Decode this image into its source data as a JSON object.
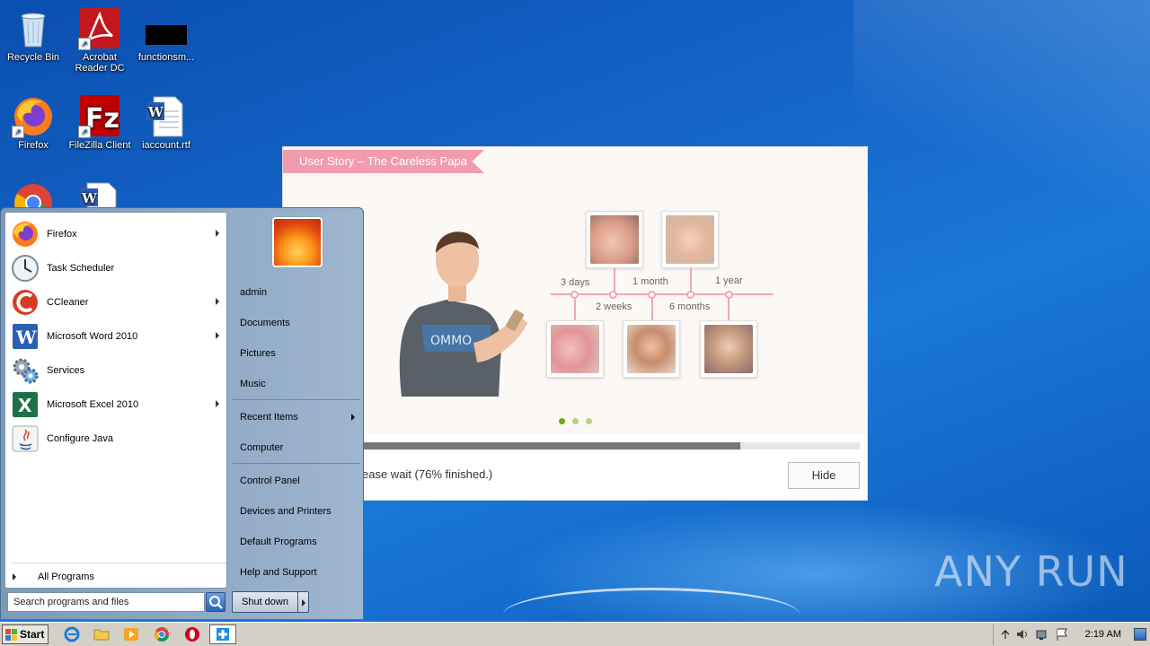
{
  "desktop": {
    "icons": [
      {
        "label": "Recycle Bin",
        "icon": "recycle-bin-icon"
      },
      {
        "label": "Acrobat Reader DC",
        "icon": "acrobat-icon"
      },
      {
        "label": "functionsm...",
        "icon": "black-file-icon"
      },
      {
        "label": "Firefox",
        "icon": "firefox-icon"
      },
      {
        "label": "FileZilla Client",
        "icon": "filezilla-icon"
      },
      {
        "label": "iaccount.rtf",
        "icon": "word-doc-icon"
      }
    ],
    "watermark": "ANY RUN"
  },
  "installer": {
    "ribbon_title": "User Story – The Careless Papa",
    "timeline_labels": [
      "3 days",
      "2 weeks",
      "1 month",
      "6 months",
      "1 year"
    ],
    "status_text": "ease wait (76% finished.)",
    "progress": 0.76,
    "hide_label": "Hide",
    "colors": {
      "ribbon": "#f29bb0",
      "pager_active": "#6aa81a",
      "pager_inactive": "#b8d27c"
    }
  },
  "start_menu": {
    "pinned": [
      {
        "label": "Firefox",
        "icon": "firefox-icon",
        "submenu": true
      },
      {
        "label": "Task Scheduler",
        "icon": "clock-icon",
        "submenu": false
      },
      {
        "label": "CCleaner",
        "icon": "ccleaner-icon",
        "submenu": true
      },
      {
        "label": "Microsoft Word 2010",
        "icon": "word-icon",
        "submenu": true
      },
      {
        "label": "Services",
        "icon": "gears-icon",
        "submenu": false
      },
      {
        "label": "Microsoft Excel 2010",
        "icon": "excel-icon",
        "submenu": true
      },
      {
        "label": "Configure Java",
        "icon": "java-icon",
        "submenu": false
      }
    ],
    "all_programs": "All Programs",
    "search_placeholder": "Search programs and files",
    "right_items": [
      "admin",
      "Documents",
      "Pictures",
      "Music",
      "Recent Items",
      "Computer",
      "Control Panel",
      "Devices and Printers",
      "Default Programs",
      "Help and Support"
    ],
    "shutdown_label": "Shut down"
  },
  "taskbar": {
    "start_label": "Start",
    "clock": "2:19 AM"
  }
}
